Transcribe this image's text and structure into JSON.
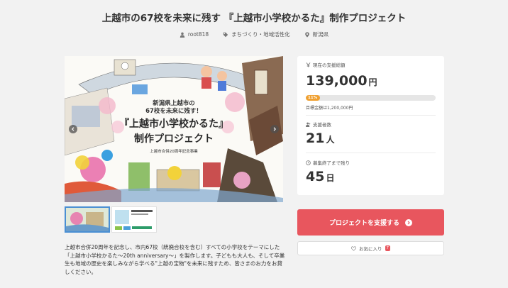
{
  "project": {
    "title": "上越市の67校を未来に残す 『上越市小学校かるた』制作プロジェクト",
    "author": "root818",
    "category": "まちづくり・地域活性化",
    "location": "新潟県"
  },
  "hero": {
    "subtitle_line1": "新潟県上越市の",
    "subtitle_line2": "67校を未来に残す！",
    "main_line1": "『上越市小学校かるた』",
    "main_line2": "制作プロジェクト",
    "small": "上越市合併20周年記念事業"
  },
  "description": "上越市合併20周年を記念し、市内67校（統廃合校を含む）すべての小学校をテーマにした「上越市小学校かるた～20th anniversary～」を製作します。子どもも大人も、そして卒業生も地域の歴史を楽しみながら学べる\"上越の宝物\"を未来に残すため、皆さまのお力をお貸しください。",
  "stats": {
    "raised_label": "現在の支援総額",
    "raised_value": "139,000",
    "raised_unit": "円",
    "progress_percent": 11,
    "progress_label": "11%",
    "goal_text": "目標金額は1,200,000円",
    "supporters_label": "支援者数",
    "supporters_value": "21",
    "supporters_unit": "人",
    "remaining_label": "募集終了まで残り",
    "remaining_value": "45",
    "remaining_unit": "日"
  },
  "actions": {
    "support_label": "プロジェクトを支援する",
    "favorite_label": "お気に入り",
    "favorite_count": "7"
  },
  "colors": {
    "accent": "#e8565e",
    "progress": "#f0a030"
  }
}
